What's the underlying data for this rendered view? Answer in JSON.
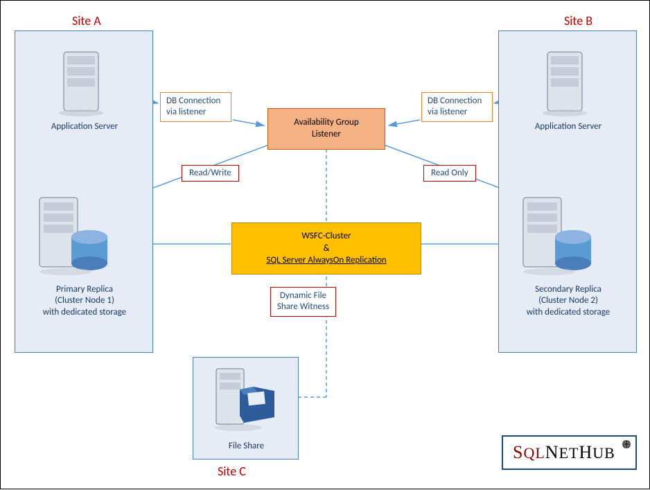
{
  "sites": {
    "a": {
      "label": "Site A"
    },
    "b": {
      "label": "Site B"
    },
    "c": {
      "label": "Site C"
    }
  },
  "app_server_a": {
    "label": "Application Server"
  },
  "app_server_b": {
    "label": "Application Server"
  },
  "conn_a": {
    "line1": "DB Connection",
    "line2": "via listener"
  },
  "conn_b": {
    "line1": "DB Connection",
    "line2": "via listener"
  },
  "ag_listener": {
    "line1": "Availability Group",
    "line2": "Listener"
  },
  "rw_label": "Read/Write",
  "ro_label": "Read Only",
  "wsfc": {
    "line1": "WSFC-Cluster",
    "line2": "&",
    "line3": "SQL Server AlwaysOn Replication"
  },
  "primary": {
    "line1": "Primary Replica",
    "line2": "(Cluster Node 1)",
    "line3": "with dedicated storage"
  },
  "secondary": {
    "line1": "Secondary Replica",
    "line2": "(Cluster Node 2)",
    "line3": "with dedicated storage"
  },
  "dfsw": {
    "line1": "Dynamic File",
    "line2": "Share Witness"
  },
  "fileshare": {
    "label": "File Share"
  },
  "logo": {
    "s1": "S",
    "ql": "QL",
    "n": "N",
    "et": "ET",
    "h": "H",
    "ub": "UB"
  }
}
